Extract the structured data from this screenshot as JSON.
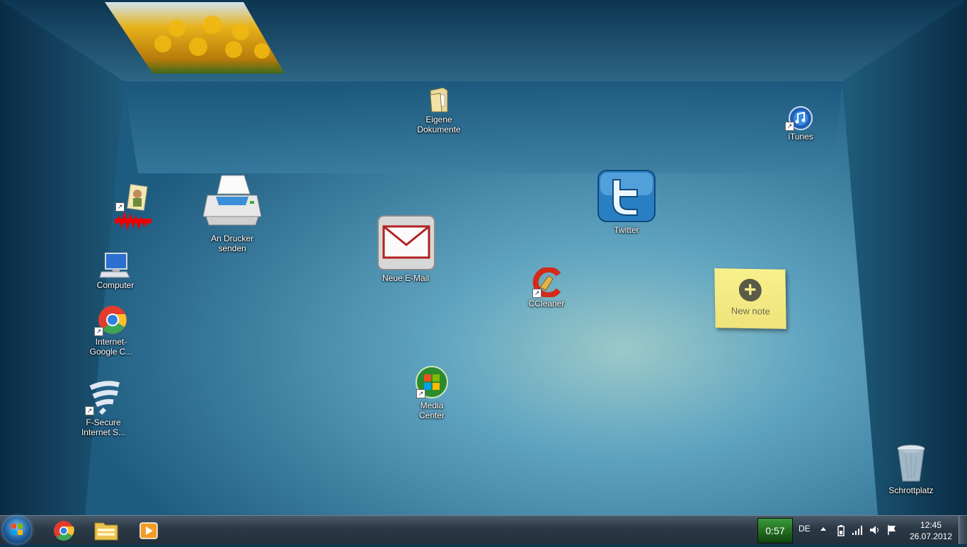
{
  "desktop": {
    "icons": [
      {
        "id": "eigene-dokumente",
        "label": "Eigene\nDokumente",
        "icon": "folder-documents-icon"
      },
      {
        "id": "itunes",
        "label": "iTunes",
        "icon": "itunes-icon"
      },
      {
        "id": "twitter",
        "label": "Twitter",
        "icon": "twitter-icon"
      },
      {
        "id": "an-drucker",
        "label": "An Drucker\nsenden",
        "icon": "printer-icon"
      },
      {
        "id": "neue-email",
        "label": "Neue E-Mail",
        "icon": "mail-icon"
      },
      {
        "id": "ccleaner",
        "label": "CCleaner",
        "icon": "ccleaner-icon"
      },
      {
        "id": "computer",
        "label": "Computer",
        "icon": "computer-icon"
      },
      {
        "id": "chrome",
        "label": "Internet-\nGoogle C...",
        "icon": "chrome-icon"
      },
      {
        "id": "fsecure",
        "label": "F-Secure\nInternet S...",
        "icon": "fsecure-icon"
      },
      {
        "id": "media-center",
        "label": "Media\nCenter",
        "icon": "windows-media-center-icon"
      },
      {
        "id": "schrottplatz",
        "label": "Schrottplatz",
        "icon": "recycle-bin-icon"
      }
    ],
    "note": {
      "label": "New note",
      "icon": "plus-icon"
    },
    "ceiling_photo": "yellow-tulips-photo"
  },
  "taskbar": {
    "pinned": [
      "start-orb-icon",
      "chrome-icon",
      "explorer-icon",
      "media-player-icon"
    ],
    "battery_meter": "0:57",
    "language": "DE",
    "tray_icons": [
      "show-hidden-icons-arrow",
      "battery-icon",
      "network-icon",
      "volume-icon",
      "action-center-flag-icon"
    ],
    "clock": {
      "time": "12:45",
      "date": "26.07.2012"
    }
  },
  "colors": {
    "wall_dark": "#0d3550",
    "floor_light": "#5fa9c8",
    "taskbar": "#2b3845",
    "note": "#f3ea86",
    "battery_green": "#2f8a2e"
  }
}
